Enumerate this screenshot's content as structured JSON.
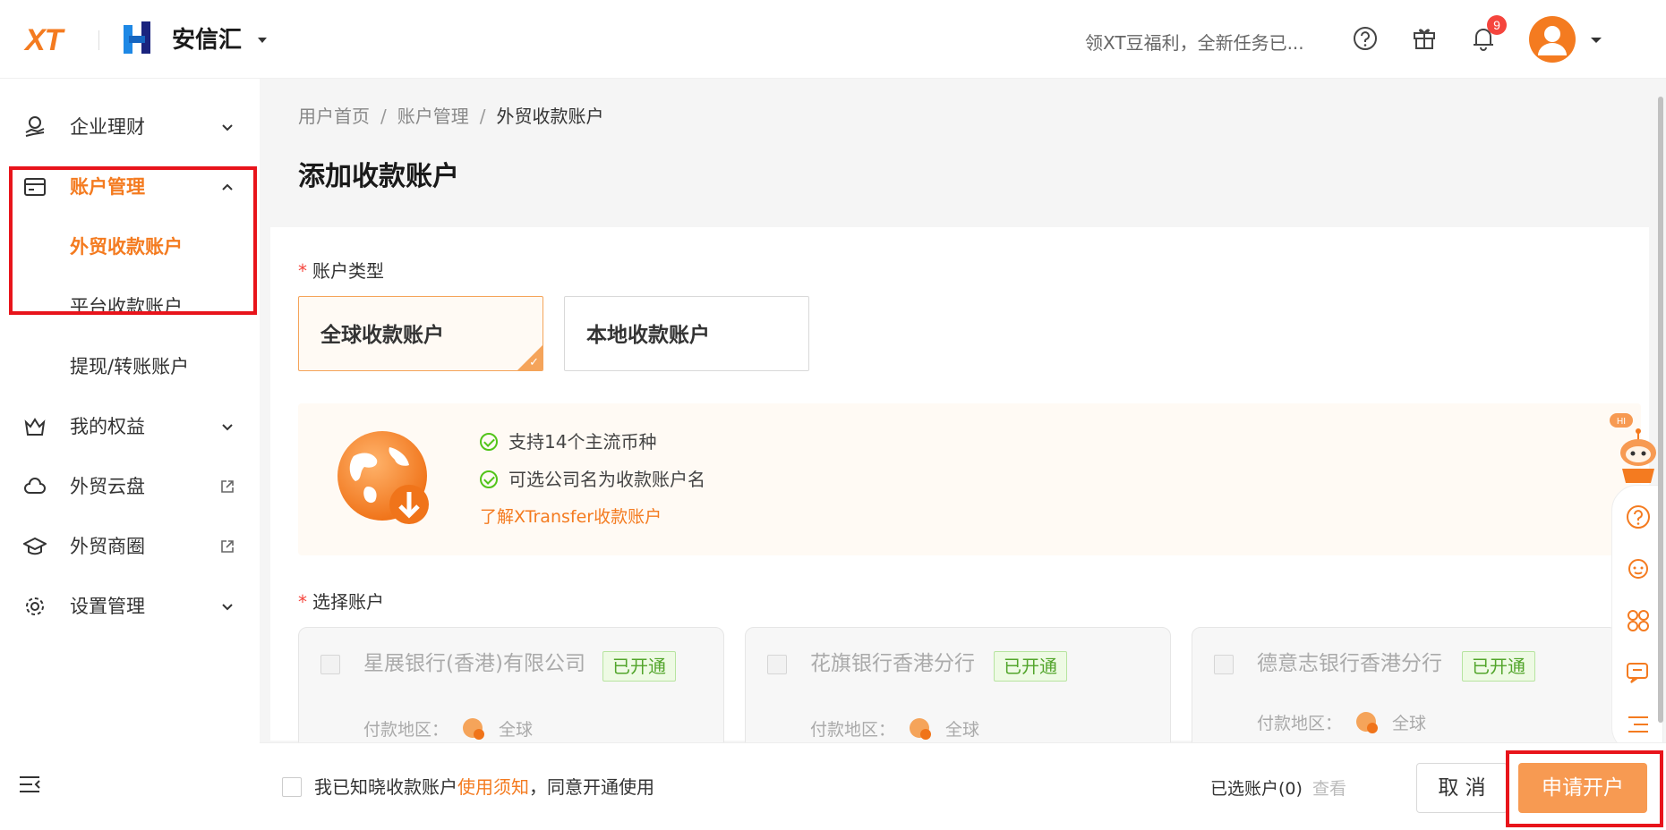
{
  "header": {
    "logo_text": "XT",
    "brand": "安信汇",
    "promo": "领XT豆福利，全新任务已...",
    "notification_count": "9"
  },
  "sidebar": {
    "items": [
      {
        "label": "企业理财",
        "icon": "coin-hand-icon"
      },
      {
        "label": "账户管理",
        "icon": "card-icon"
      },
      {
        "label": "我的权益",
        "icon": "crown-icon"
      },
      {
        "label": "外贸云盘",
        "icon": "cloud-icon"
      },
      {
        "label": "外贸商圈",
        "icon": "graduation-cap-icon"
      },
      {
        "label": "设置管理",
        "icon": "gear-icon"
      }
    ],
    "subitems": [
      {
        "label": "外贸收款账户"
      },
      {
        "label": "平台收款账户"
      },
      {
        "label": "提现/转账账户"
      }
    ]
  },
  "breadcrumb": [
    "用户首页",
    "账户管理",
    "外贸收款账户"
  ],
  "page_title": "添加收款账户",
  "form": {
    "account_type_label": "账户类型",
    "account_types": [
      "全球收款账户",
      "本地收款账户"
    ],
    "selected_type": "全球收款账户",
    "features": [
      "支持14个主流币种",
      "可选公司名为收款账户名"
    ],
    "learn_more": "了解XTransfer收款账户",
    "select_account_label": "选择账户",
    "banks": [
      {
        "name": "星展银行(香港)有限公司",
        "status": "已开通",
        "region_label": "付款地区：",
        "region": "全球"
      },
      {
        "name": "花旗银行香港分行",
        "status": "已开通",
        "region_label": "付款地区：",
        "region": "全球"
      },
      {
        "name": "德意志银行香港分行",
        "status": "已开通",
        "region_label": "付款地区：",
        "region": "全球"
      }
    ]
  },
  "footer": {
    "agree_prefix": "我已知晓收款账户",
    "agree_link": "使用须知",
    "agree_suffix": "，同意开通使用",
    "selected": "已选账户(0)",
    "view": "查看",
    "cancel": "取 消",
    "apply": "申请开户"
  },
  "float_badge": "HI",
  "colors": {
    "accent": "#f47b20",
    "highlight_box": "#e8141b",
    "success": "#52c41a"
  }
}
